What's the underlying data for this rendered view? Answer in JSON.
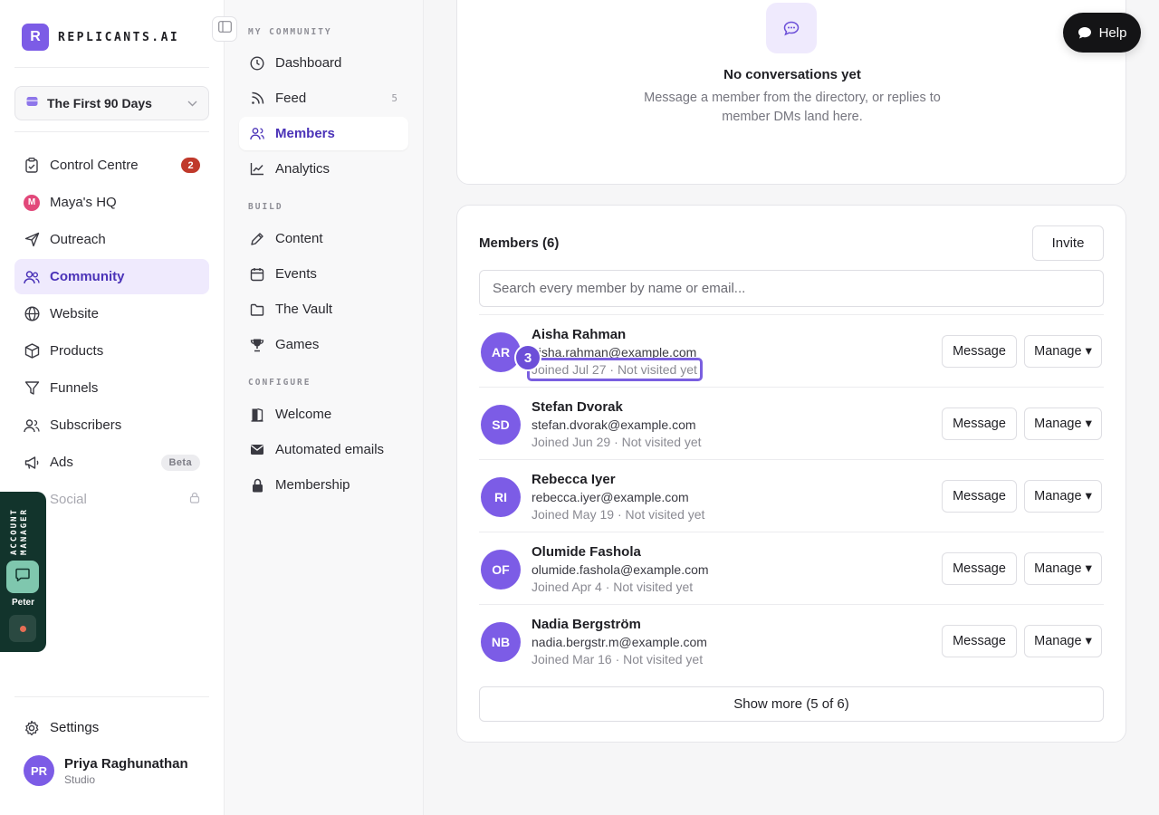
{
  "brand": {
    "logo_letter": "R",
    "name": "REPLICANTS.AI",
    "accent": "#7c5ce6"
  },
  "workspace": {
    "selected": "The First 90 Days"
  },
  "sidebar": {
    "items": [
      {
        "label": "Control Centre",
        "icon": "clipboard-check-icon",
        "badge": "2"
      },
      {
        "label": "Maya's HQ",
        "icon": "maya-avatar-icon",
        "avatar_letter": "M"
      },
      {
        "label": "Outreach",
        "icon": "send-icon"
      },
      {
        "label": "Community",
        "icon": "users-icon",
        "active": true
      },
      {
        "label": "Website",
        "icon": "globe-icon"
      },
      {
        "label": "Products",
        "icon": "box-icon"
      },
      {
        "label": "Funnels",
        "icon": "funnel-icon"
      },
      {
        "label": "Subscribers",
        "icon": "user-group-icon"
      },
      {
        "label": "Ads",
        "icon": "megaphone-icon",
        "badge": "Beta"
      },
      {
        "label": "Social",
        "icon": "lock-icon",
        "locked": true
      }
    ],
    "settings_label": "Settings",
    "user": {
      "initials": "PR",
      "name": "Priya Raghunathan",
      "plan": "Studio"
    }
  },
  "account_manager": {
    "label": "ACCOUNT MANAGER",
    "name": "Peter"
  },
  "subnav": {
    "sections": [
      {
        "heading": "MY COMMUNITY",
        "items": [
          {
            "label": "Dashboard",
            "icon": "clock-icon"
          },
          {
            "label": "Feed",
            "icon": "rss-icon",
            "count": "5"
          },
          {
            "label": "Members",
            "icon": "members-icon",
            "active": true
          },
          {
            "label": "Analytics",
            "icon": "chart-line-icon"
          }
        ]
      },
      {
        "heading": "BUILD",
        "items": [
          {
            "label": "Content",
            "icon": "pen-icon"
          },
          {
            "label": "Events",
            "icon": "calendar-icon"
          },
          {
            "label": "The Vault",
            "icon": "folder-icon"
          },
          {
            "label": "Games",
            "icon": "trophy-icon"
          }
        ]
      },
      {
        "heading": "CONFIGURE",
        "items": [
          {
            "label": "Welcome",
            "icon": "door-icon"
          },
          {
            "label": "Automated emails",
            "icon": "mail-icon"
          },
          {
            "label": "Membership",
            "icon": "padlock-icon"
          }
        ]
      }
    ]
  },
  "conversations": {
    "empty_title": "No conversations yet",
    "empty_text": "Message a member from the directory, or replies to member DMs land here."
  },
  "members": {
    "title": "Members (6)",
    "invite_label": "Invite",
    "search_placeholder": "Search every member by name or email...",
    "message_label": "Message",
    "manage_label": "Manage ▾",
    "list": [
      {
        "initials": "AR",
        "name": "Aisha Rahman",
        "email": "aisha.rahman@example.com",
        "joined": "Joined Jul 27 · Not visited yet"
      },
      {
        "initials": "SD",
        "name": "Stefan Dvorak",
        "email": "stefan.dvorak@example.com",
        "joined": "Joined Jun 29 · Not visited yet"
      },
      {
        "initials": "RI",
        "name": "Rebecca Iyer",
        "email": "rebecca.iyer@example.com",
        "joined": "Joined May 19 · Not visited yet"
      },
      {
        "initials": "OF",
        "name": "Olumide Fashola",
        "email": "olumide.fashola@example.com",
        "joined": "Joined Apr 4 · Not visited yet"
      },
      {
        "initials": "NB",
        "name": "Nadia Bergström",
        "email": "nadia.bergstr.m@example.com",
        "joined": "Joined Mar 16 · Not visited yet"
      }
    ],
    "show_more_label": "Show more (5 of 6)",
    "highlight_step": "3"
  },
  "help": {
    "label": "Help"
  }
}
